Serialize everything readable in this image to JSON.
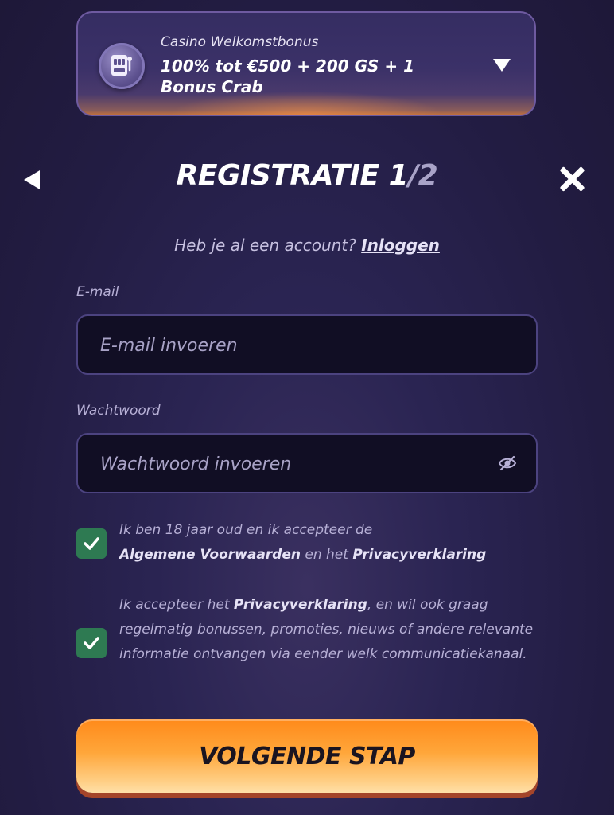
{
  "bonus": {
    "subtitle": "Casino Welkomstbonus",
    "title": "100% tot €500 + 200 GS + 1 Bonus Crab",
    "icon": "slot-machine-icon"
  },
  "header": {
    "title": "REGISTRATIE 1",
    "step_total": "/2",
    "back_icon": "back-arrow-icon",
    "close_icon": "close-icon"
  },
  "login": {
    "prompt": "Heb je al een account?",
    "link": "Inloggen"
  },
  "form": {
    "email": {
      "label": "E-mail",
      "value": "",
      "placeholder": "E-mail invoeren"
    },
    "password": {
      "label": "Wachtwoord",
      "value": "",
      "placeholder": "Wachtwoord invoeren",
      "toggle_icon": "eye-off-icon"
    }
  },
  "consents": {
    "terms": {
      "checked": true,
      "text_before": "Ik ben 18 jaar oud en ik accepteer de",
      "link1": "Algemene Voorwaarden",
      "text_middle": "en het",
      "link2": "Privacyverklaring"
    },
    "marketing": {
      "checked": true,
      "text_before": "Ik accepteer het",
      "link": "Privacyverklaring",
      "text_after": ", en wil ook graag regelmatig bonussen, promoties, nieuws of andere relevante informatie ontvangen via eender welk communicatiekanaal."
    }
  },
  "actions": {
    "next_label": "VOLGENDE STAP"
  },
  "colors": {
    "background": "#221c42",
    "checkbox": "#2e7a52",
    "button_top": "#ff8a1a",
    "button_bottom": "#ffe0a8"
  }
}
